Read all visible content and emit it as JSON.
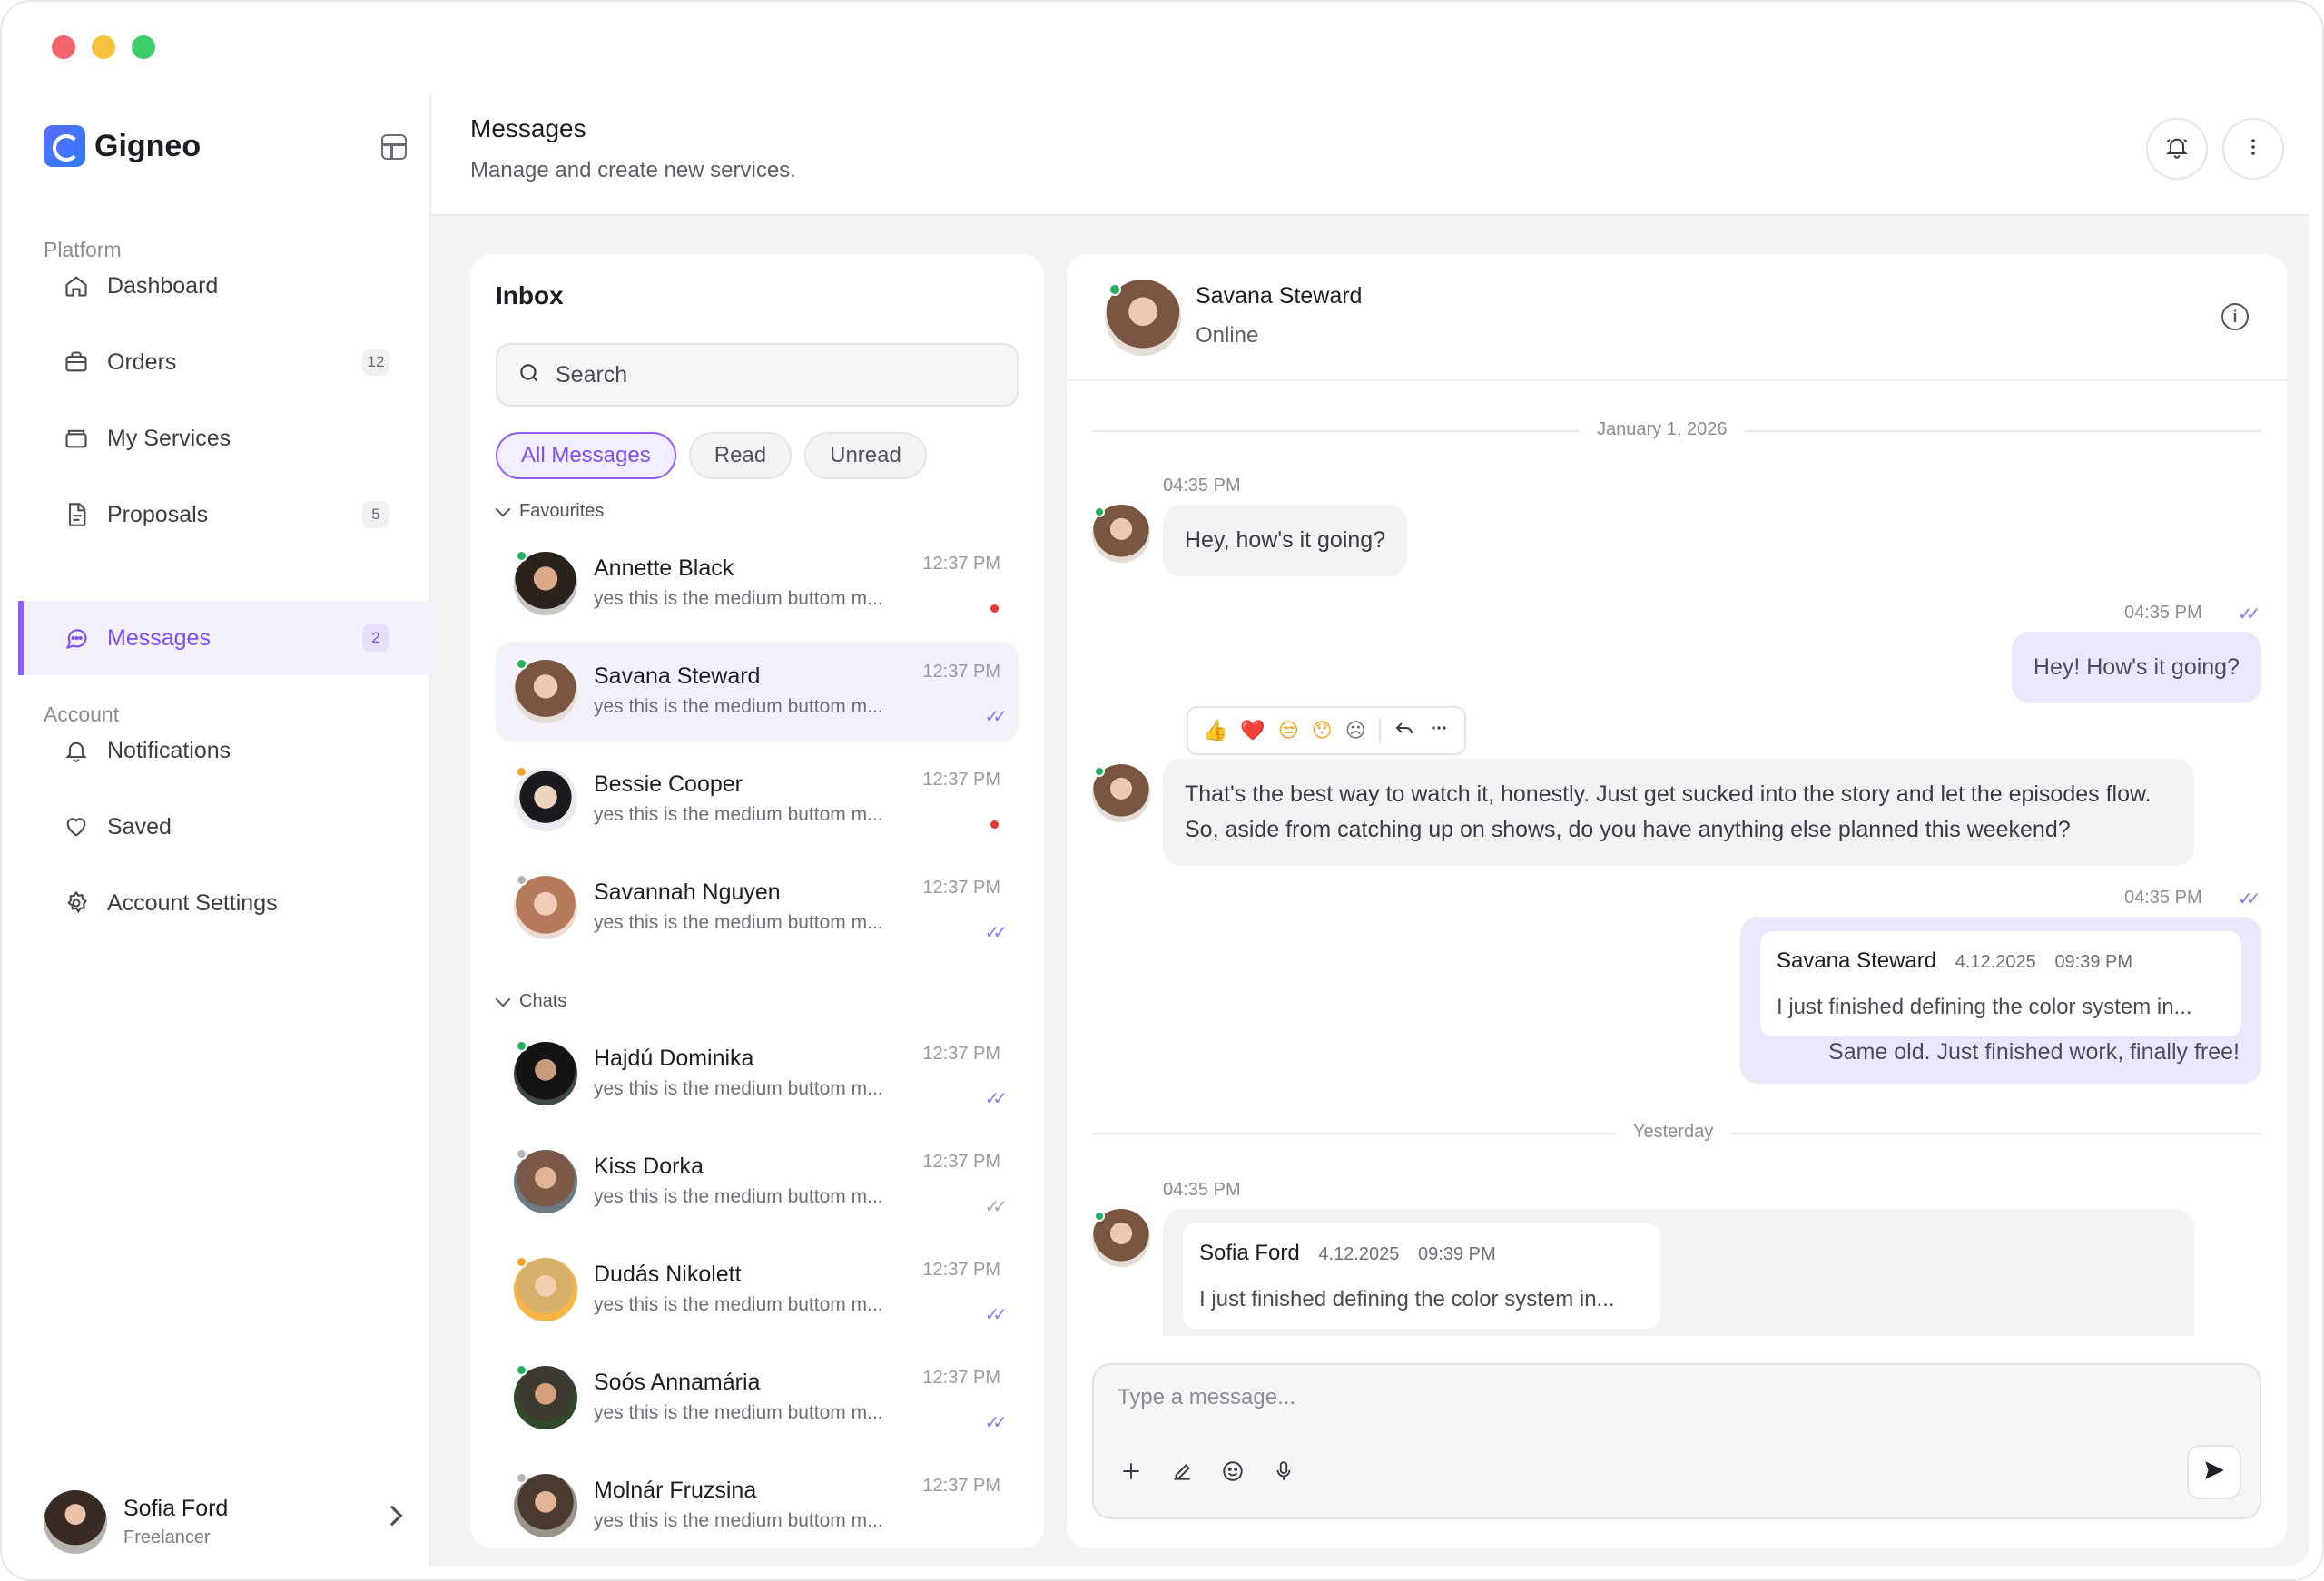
{
  "brand": {
    "name": "Gigneo"
  },
  "sidebar": {
    "platform_label": "Platform",
    "account_label": "Account",
    "platform_items": [
      {
        "label": "Dashboard",
        "icon": "home-icon",
        "badge": ""
      },
      {
        "label": "Orders",
        "icon": "briefcase-icon",
        "badge": "12"
      },
      {
        "label": "My Services",
        "icon": "box-icon",
        "badge": ""
      },
      {
        "label": "Proposals",
        "icon": "document-icon",
        "badge": "5"
      },
      {
        "label": "Messages",
        "icon": "chat-icon",
        "badge": "2",
        "active": true
      }
    ],
    "account_items": [
      {
        "label": "Notifications",
        "icon": "bell-icon"
      },
      {
        "label": "Saved",
        "icon": "heart-icon"
      },
      {
        "label": "Account Settings",
        "icon": "gear-icon"
      }
    ],
    "profile": {
      "name": "Sofia Ford",
      "role": "Freelancer"
    }
  },
  "header": {
    "title": "Messages",
    "subtitle": "Manage and create new services."
  },
  "inbox": {
    "title": "Inbox",
    "search_placeholder": "Search",
    "filters": [
      "All Messages",
      "Read",
      "Unread"
    ],
    "favourites_label": "Favourites",
    "chats_label": "Chats",
    "favourites": [
      {
        "name": "Annette Black",
        "preview": "yes this is the medium buttom m...",
        "time": "12:37 PM",
        "status": "unread",
        "presence": "#22b15e"
      },
      {
        "name": "Savana Steward",
        "preview": "yes this is the medium buttom m...",
        "time": "12:37 PM",
        "status": "read",
        "presence": "#22b15e",
        "selected": true
      },
      {
        "name": "Bessie Cooper",
        "preview": "yes this is the medium buttom m...",
        "time": "12:37 PM",
        "status": "unread",
        "presence": "#f5a524"
      },
      {
        "name": "Savannah Nguyen",
        "preview": "yes this is the medium buttom m...",
        "time": "12:37 PM",
        "status": "read",
        "presence": "#b5b5bd"
      }
    ],
    "chats": [
      {
        "name": "Hajdú Dominika",
        "preview": "yes this is the medium buttom m...",
        "time": "12:37 PM",
        "status": "read",
        "presence": "#22b15e"
      },
      {
        "name": "Kiss Dorka",
        "preview": "yes this is the medium buttom m...",
        "time": "12:37 PM",
        "status": "delivered",
        "presence": "#b5b5bd"
      },
      {
        "name": "Dudás Nikolett",
        "preview": "yes this is the medium buttom m...",
        "time": "12:37 PM",
        "status": "read",
        "presence": "#f5a524"
      },
      {
        "name": "Soós Annamária",
        "preview": "yes this is the medium buttom m...",
        "time": "12:37 PM",
        "status": "read",
        "presence": "#22b15e"
      },
      {
        "name": "Molnár Fruzsina",
        "preview": "yes this is the medium buttom m...",
        "time": "12:37 PM",
        "status": "read",
        "presence": "#b5b5bd"
      }
    ]
  },
  "chat": {
    "contact_name": "Savana Steward",
    "contact_status": "Online",
    "date_1": "January 1, 2026",
    "date_2": "Yesterday",
    "messages": [
      {
        "time": "04:35 PM",
        "text": "Hey, how's it going?"
      },
      {
        "time": "04:35 PM",
        "text": "Hey! How's it going?"
      },
      {
        "text": "That's the best way to watch it, honestly. Just get sucked into the story and let the episodes flow. So, aside from catching up on shows, do you have anything else planned this weekend?"
      },
      {
        "time": "04:35 PM",
        "quote_name": "Savana Steward",
        "quote_date": "4.12.2025",
        "quote_time": "09:39 PM",
        "quote_text": "I just finished defining the color system in...",
        "text": "Same old. Just finished work, finally free!"
      },
      {
        "time": "04:35 PM",
        "quote_name": "Sofia Ford",
        "quote_date": "4.12.2025",
        "quote_time": "09:39 PM",
        "quote_text": "I just finished defining the color system in..."
      }
    ],
    "reactions": [
      "👍",
      "❤️",
      "😒",
      "😯",
      "☹"
    ],
    "composer_placeholder": "Type a message..."
  }
}
